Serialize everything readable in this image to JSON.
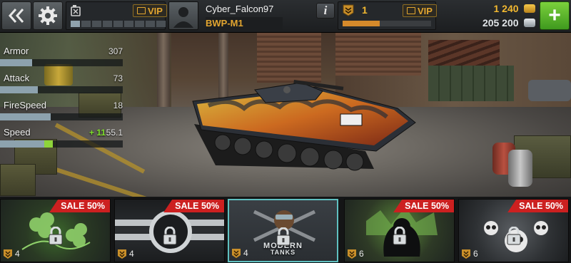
{
  "header": {
    "player_name": "Cyber_Falcon97",
    "tank_name": "BWP-M1",
    "vip_label_left": "VIP",
    "vip_label_right": "VIP",
    "rank_level": "1",
    "xp_progress": 0.42,
    "fuel_level": 0.07,
    "gold": "1 240",
    "silver": "205 200",
    "info_label": "i",
    "add_label": "+"
  },
  "stats": [
    {
      "name": "Armor",
      "value": "307",
      "bonus": "",
      "level": 0.26,
      "bonus_level": 0
    },
    {
      "name": "Attack",
      "value": "73",
      "bonus": "",
      "level": 0.31,
      "bonus_level": 0
    },
    {
      "name": "FireSpeed",
      "value": "18",
      "bonus": "",
      "level": 0.41,
      "bonus_level": 0
    },
    {
      "name": "Speed",
      "value": "55.1",
      "bonus": "+ 11",
      "level": 0.36,
      "bonus_level": 0.07
    }
  ],
  "cards": [
    {
      "sale": "SALE 50%",
      "rank": "4",
      "selected": false,
      "theme": "clover"
    },
    {
      "sale": "SALE 50%",
      "rank": "4",
      "selected": false,
      "theme": "star"
    },
    {
      "sale": "",
      "rank": "4",
      "selected": true,
      "theme": "modern",
      "logo_text_1": "MODERN",
      "logo_text_2": "TANKS"
    },
    {
      "sale": "SALE 50%",
      "rank": "6",
      "selected": false,
      "theme": "gorilla"
    },
    {
      "sale": "SALE 50%",
      "rank": "6",
      "selected": false,
      "theme": "skull"
    }
  ],
  "colors": {
    "gold": "#f2b830",
    "vip": "#e3a630",
    "sale": "#cc2020",
    "bonus": "#7fe02c",
    "accent_green": "#5fb82a",
    "selected_border": "#5fc0c0"
  }
}
